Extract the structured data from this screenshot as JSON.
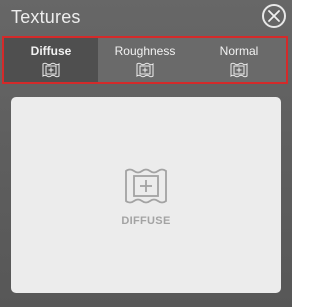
{
  "panel": {
    "title": "Textures",
    "close_icon": "close-icon"
  },
  "tabs": [
    {
      "label": "Diffuse",
      "icon": "add-texture-icon",
      "active": true
    },
    {
      "label": "Roughness",
      "icon": "add-texture-icon",
      "active": false
    },
    {
      "label": "Normal",
      "icon": "add-texture-icon",
      "active": false
    }
  ],
  "highlight_color": "#d42a2a",
  "drop_area": {
    "icon": "add-texture-icon",
    "label": "DIFFUSE"
  }
}
